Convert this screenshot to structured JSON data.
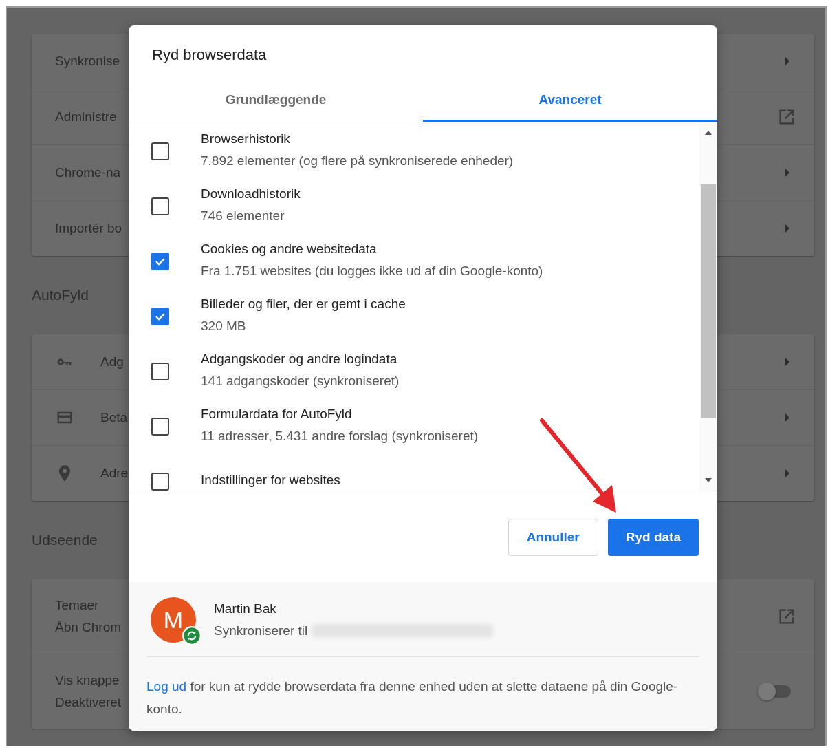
{
  "page": {
    "sections": [
      {
        "rows": [
          {
            "label": "Synkronise",
            "kind": "arrow"
          },
          {
            "label": "Administre",
            "kind": "external"
          },
          {
            "label": "Chrome-na",
            "kind": "arrow"
          },
          {
            "label": "Importér bo",
            "kind": "arrow"
          }
        ]
      },
      {
        "heading": "AutoFyld",
        "rows": [
          {
            "label": "Adg",
            "kind": "arrow"
          },
          {
            "label": "Beta",
            "kind": "arrow"
          },
          {
            "label": "Adre",
            "kind": "arrow"
          }
        ]
      },
      {
        "heading": "Udseende",
        "rows": [
          {
            "label": "Temaer",
            "sublabel": "Åbn Chrom",
            "kind": "external"
          },
          {
            "label": "Vis knappe",
            "sublabel": "Deaktiveret",
            "kind": "toggle",
            "on": false
          }
        ]
      }
    ]
  },
  "dialog": {
    "title": "Ryd browserdata",
    "tabs": [
      {
        "label": "Grundlæggende",
        "selected": false
      },
      {
        "label": "Avanceret",
        "selected": true
      }
    ],
    "items": [
      {
        "label": "Browserhistorik",
        "description": "7.892 elementer (og flere på synkroniserede enheder)",
        "checked": false
      },
      {
        "label": "Downloadhistorik",
        "description": "746 elementer",
        "checked": false
      },
      {
        "label": "Cookies og andre websitedata",
        "description": "Fra 1.751 websites (du logges ikke ud af din Google-konto)",
        "checked": true
      },
      {
        "label": "Billeder og filer, der er gemt i cache",
        "description": "320 MB",
        "checked": true
      },
      {
        "label": "Adgangskoder og andre logindata",
        "description": "141 adgangskoder (synkroniseret)",
        "checked": false
      },
      {
        "label": "Formulardata for AutoFyld",
        "description": "11 adresser, 5.431 andre forslag (synkroniseret)",
        "checked": false
      },
      {
        "label": "Indstillinger for websites",
        "checked": false
      }
    ],
    "cancel": "Annuller",
    "confirm": "Ryd data",
    "account": {
      "initial": "M",
      "name": "Martin Bak",
      "sync_label": "Synkroniserer til"
    },
    "footer": {
      "link": "Log ud",
      "text": " for kun at rydde browserdata fra denne enhed uden at slette dataene på din Google-konto."
    }
  }
}
